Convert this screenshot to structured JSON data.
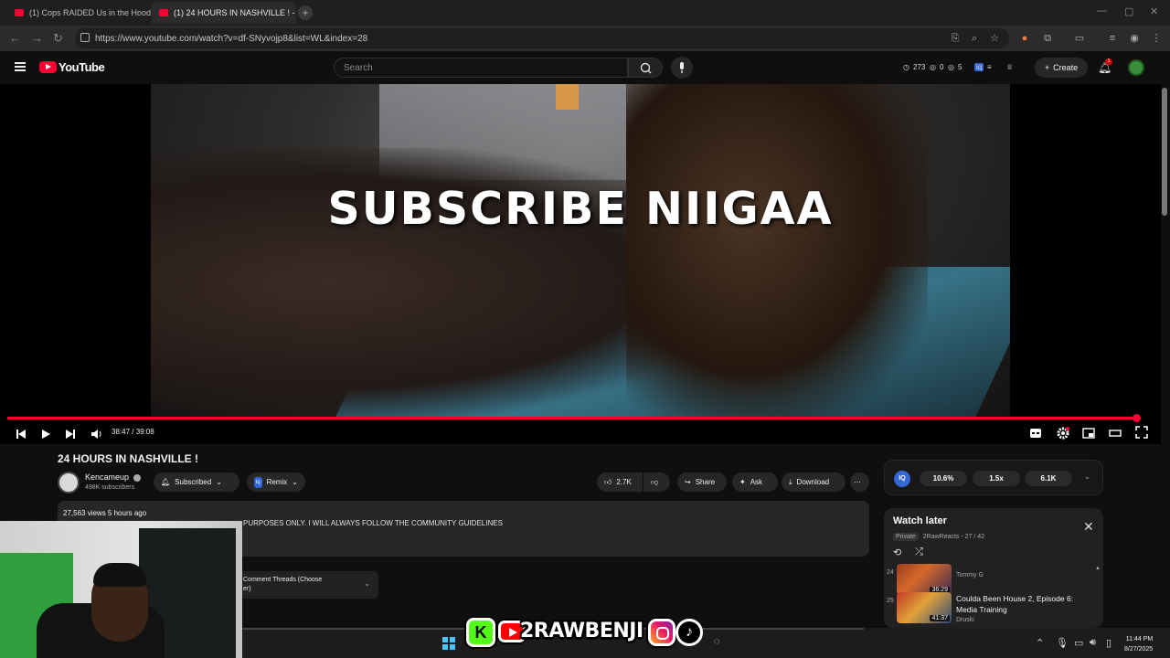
{
  "browser": {
    "tabs": [
      {
        "title": "(1) Cops RAIDED Us in the Hood..."
      },
      {
        "title": "(1) 24 HOURS IN NASHVILLE ! -"
      }
    ],
    "url": "https://www.youtube.com/watch?v=df-SNyvojp8&list=WL&index=28"
  },
  "youtube": {
    "brand": "YouTube",
    "search_placeholder": "Search",
    "stats": {
      "a": "273",
      "b": "0",
      "c": "5"
    },
    "create_label": "Create",
    "notifications": "1"
  },
  "player": {
    "overlay_text": "SUBSCRIBE NIIGAA",
    "time": "38:47 / 39:08",
    "progress": 0.991
  },
  "video": {
    "title": "24 HOURS IN NASHVILLE !",
    "channel": "Kencameup",
    "subscribers": "498K subscribers",
    "subscribed_label": "Subscribed",
    "remix_label": "Remix",
    "likes": "2.7K",
    "share_label": "Share",
    "ask_label": "Ask",
    "download_label": "Download",
    "views_line": "27,563 views  5 hours ago",
    "description_snippet": "PURPOSES ONLY. I WILL ALWAYS FOLLOW THE COMMUNITY GUIDELINES",
    "sort_label_1": "Comment Threads (Choose",
    "sort_label_2": "er)"
  },
  "iq": {
    "logo": "IQ",
    "chips": [
      "10.6%",
      "1.5x",
      "6.1K"
    ]
  },
  "playlist": {
    "title": "Watch later",
    "privacy": "Private",
    "owner": "2RawReacts",
    "position": "27 / 42",
    "items": [
      {
        "index": "24",
        "title": "",
        "channel": "Tommy G",
        "duration": "36:29"
      },
      {
        "index": "25",
        "title": "Coulda Been House 2, Episode 6: Media Training",
        "channel": "Druski",
        "duration": "41:37"
      }
    ]
  },
  "overlay": {
    "streamer_name": "2RAWBENJI"
  },
  "taskbar": {
    "time": "11:44 PM",
    "date": "8/27/2025"
  }
}
